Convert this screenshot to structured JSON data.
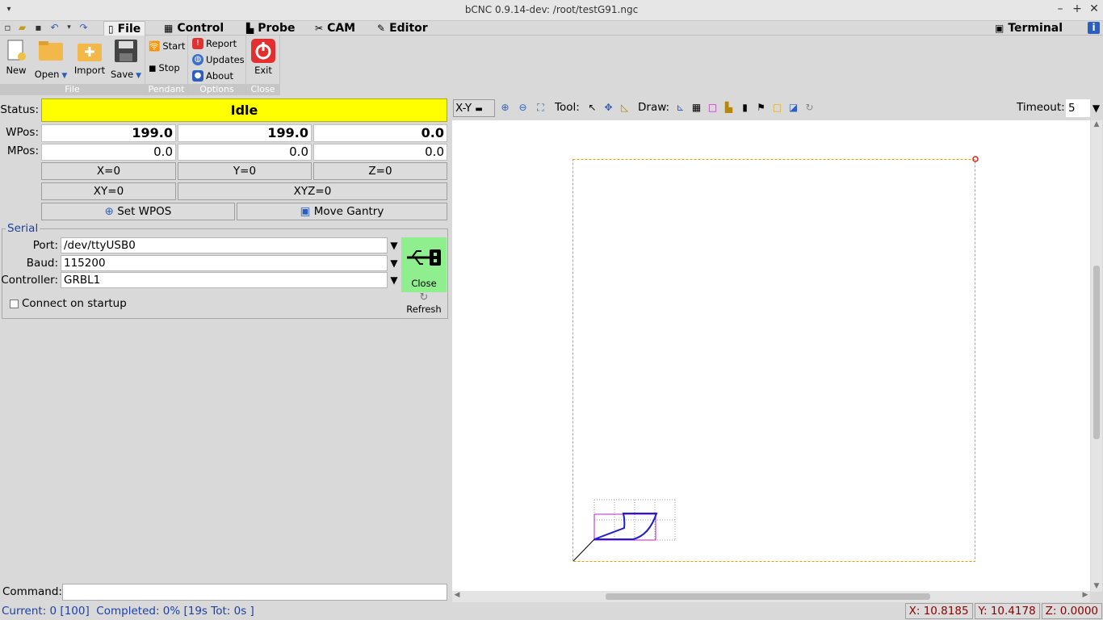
{
  "window": {
    "title": "bCNC 0.9.14-dev: /root/testG91.ngc"
  },
  "tabs": [
    {
      "label": "File"
    },
    {
      "label": "Control"
    },
    {
      "label": "Probe"
    },
    {
      "label": "CAM"
    },
    {
      "label": "Editor"
    },
    {
      "label": "Terminal"
    }
  ],
  "ribbon": {
    "file": {
      "new": "New",
      "open": "Open",
      "import": "Import",
      "save": "Save",
      "group": "File"
    },
    "pendant": {
      "start": "Start",
      "stop": "Stop",
      "group": "Pendant"
    },
    "options": {
      "report": "Report",
      "updates": "Updates",
      "about": "About",
      "group": "Options"
    },
    "close": {
      "exit": "Exit",
      "group": "Close"
    }
  },
  "dro": {
    "status_label": "Status:",
    "status": "Idle",
    "wpos_label": "WPos:",
    "wpos": [
      "199.0",
      "199.0",
      "0.0"
    ],
    "mpos_label": "MPos:",
    "mpos": [
      "0.0",
      "0.0",
      "0.0"
    ],
    "zero_x": "X=0",
    "zero_y": "Y=0",
    "zero_z": "Z=0",
    "zero_xy": "XY=0",
    "zero_xyz": "XYZ=0",
    "set_wpos": "Set WPOS",
    "move_gantry": "Move Gantry"
  },
  "serial": {
    "legend": "Serial",
    "port_label": "Port:",
    "port": "/dev/ttyUSB0",
    "baud_label": "Baud:",
    "baud": "115200",
    "controller_label": "Controller:",
    "controller": "GRBL1",
    "close": "Close",
    "refresh": "Refresh",
    "connect_startup": "Connect on startup"
  },
  "command": {
    "label": "Command:",
    "value": ""
  },
  "statusbar": {
    "text": "Current: 0 [100]  Completed: 0% [19s Tot: 0s ]",
    "x": "X: 10.8185",
    "y": "Y: 10.4178",
    "z": "Z: 0.0000"
  },
  "canvas": {
    "view": "X-Y",
    "tool_label": "Tool:",
    "draw_label": "Draw:",
    "timeout_label": "Timeout:",
    "timeout": "5"
  }
}
